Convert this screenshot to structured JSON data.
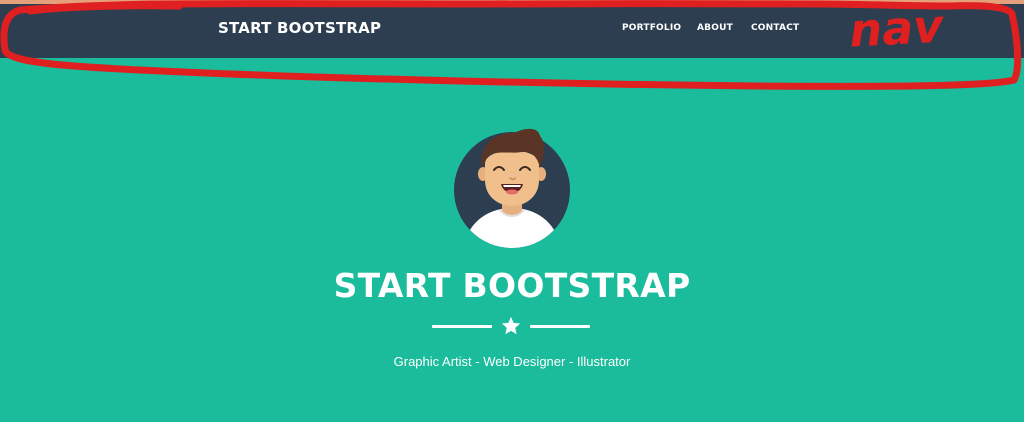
{
  "navbar": {
    "brand": "START BOOTSTRAP",
    "links": [
      {
        "label": "PORTFOLIO"
      },
      {
        "label": "ABOUT"
      },
      {
        "label": "CONTACT"
      }
    ]
  },
  "annotation": {
    "label": "nav",
    "color": "#e02020"
  },
  "hero": {
    "title": "START BOOTSTRAP",
    "subtitle": "Graphic Artist - Web Designer - Illustrator",
    "divider_icon": "star-icon"
  },
  "colors": {
    "background": "#1abc9c",
    "navbar": "#2c3e50",
    "text": "#ffffff",
    "annotation": "#e02020"
  }
}
